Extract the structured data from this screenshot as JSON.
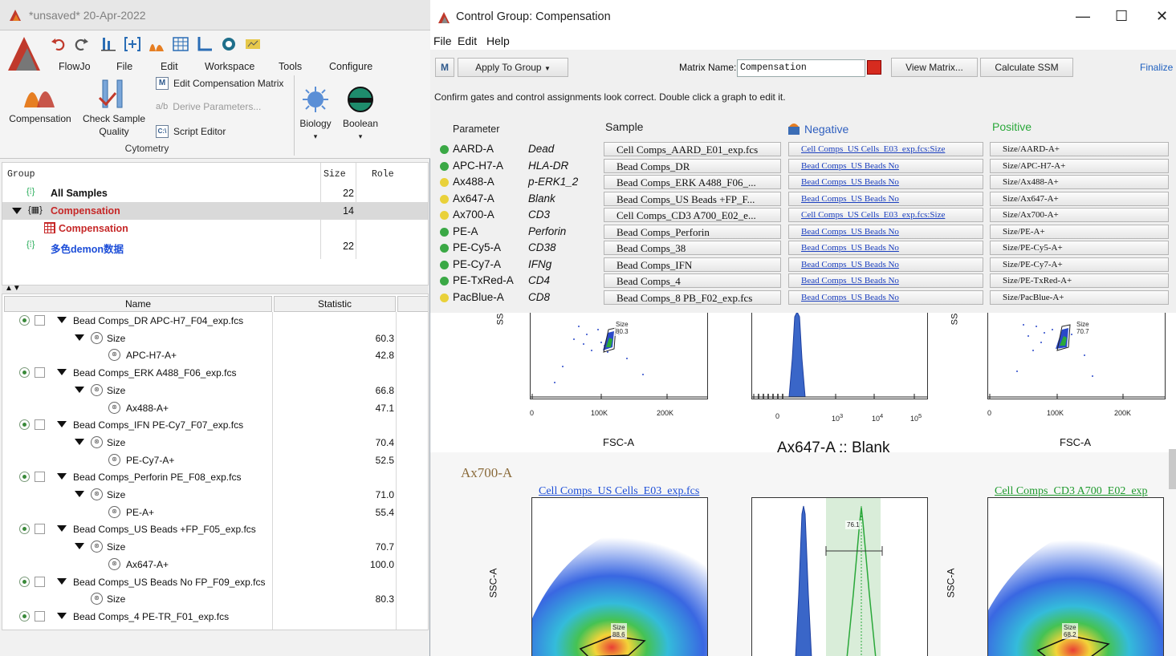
{
  "flowjo": {
    "title": "*unsaved* 20-Apr-2022",
    "menus": [
      "FlowJo",
      "File",
      "Edit",
      "Workspace",
      "Tools",
      "Configure"
    ],
    "ribbon": {
      "compensation": "Compensation",
      "check_sample_quality": "Check Sample Quality",
      "edit_comp_matrix": "Edit Compensation Matrix",
      "derive_parameters": "Derive Parameters...",
      "script_editor": "Script Editor",
      "biology": "Biology",
      "boolean": "Boolean",
      "section": "Cytometry"
    },
    "groups": {
      "headers": {
        "group": "Group",
        "size": "Size",
        "role": "Role"
      },
      "rows": [
        {
          "label": "All Samples",
          "size": "22",
          "color": "#111111"
        },
        {
          "label": "Compensation",
          "size": "14",
          "color": "#c62828"
        },
        {
          "label": "Compensation",
          "size": "",
          "color": "#c62828"
        },
        {
          "label": "多色demon数据",
          "size": "22",
          "color": "#1d4ed8"
        }
      ]
    },
    "samples": {
      "headers": {
        "name": "Name",
        "statistic": "Statistic"
      },
      "rows": [
        {
          "level": 0,
          "name": "Bead Comps_DR APC-H7_F04_exp.fcs",
          "stat": ""
        },
        {
          "level": 1,
          "name": "Size",
          "stat": "60.3"
        },
        {
          "level": 2,
          "name": "APC-H7-A+",
          "stat": "42.8"
        },
        {
          "level": 0,
          "name": "Bead Comps_ERK A488_F06_exp.fcs",
          "stat": ""
        },
        {
          "level": 1,
          "name": "Size",
          "stat": "66.8"
        },
        {
          "level": 2,
          "name": "Ax488-A+",
          "stat": "47.1"
        },
        {
          "level": 0,
          "name": "Bead Comps_IFN PE-Cy7_F07_exp.fcs",
          "stat": ""
        },
        {
          "level": 1,
          "name": "Size",
          "stat": "70.4"
        },
        {
          "level": 2,
          "name": "PE-Cy7-A+",
          "stat": "52.5"
        },
        {
          "level": 0,
          "name": "Bead Comps_Perforin PE_F08_exp.fcs",
          "stat": ""
        },
        {
          "level": 1,
          "name": "Size",
          "stat": "71.0"
        },
        {
          "level": 2,
          "name": "PE-A+",
          "stat": "55.4"
        },
        {
          "level": 0,
          "name": "Bead Comps_US Beads +FP_F05_exp.fcs",
          "stat": ""
        },
        {
          "level": 1,
          "name": "Size",
          "stat": "70.7"
        },
        {
          "level": 2,
          "name": "Ax647-A+",
          "stat": "100.0"
        },
        {
          "level": 0,
          "name": "Bead Comps_US Beads No FP_F09_exp.fcs",
          "stat": ""
        },
        {
          "level": 1,
          "name": "Size",
          "stat": "80.3",
          "nochild": true
        },
        {
          "level": 0,
          "name": "Bead Comps_4 PE-TR_F01_exp.fcs",
          "stat": ""
        }
      ]
    }
  },
  "cg": {
    "title": "Control Group: Compensation",
    "menus": [
      "File",
      "Edit",
      "Help"
    ],
    "apply_to_group": "Apply To Group",
    "matrix_label": "Matrix Name:",
    "matrix_name": "Compensation",
    "view_matrix": "View Matrix...",
    "calculate_ssm": "Calculate SSM",
    "finalize": "Finalize",
    "confirm_text": "Confirm gates and control assignments look correct. Double click a graph to edit it.",
    "table_headers": {
      "parameter": "Parameter",
      "sample": "Sample",
      "negative": "Negative",
      "positive": "Positive"
    },
    "params": [
      {
        "name": "AARD-A",
        "marker": "Dead",
        "status": "#3aa845",
        "sample": "Cell Comps_AARD_E01_exp.fcs",
        "negative": "Cell Comps_US Cells_E03_exp.fcs:Size",
        "positive": "Size/AARD-A+"
      },
      {
        "name": "APC-H7-A",
        "marker": "HLA-DR",
        "status": "#3aa845",
        "sample": "Bead Comps_DR",
        "negative": "Bead Comps_US Beads No",
        "positive": "Size/APC-H7-A+"
      },
      {
        "name": "Ax488-A",
        "marker": "p-ERK1_2",
        "status": "#e9d13a",
        "sample": "Bead Comps_ERK A488_F06_...",
        "negative": "Bead Comps_US Beads No",
        "positive": "Size/Ax488-A+"
      },
      {
        "name": "Ax647-A",
        "marker": "Blank",
        "status": "#e9d13a",
        "sample": "Bead Comps_US Beads +FP_F...",
        "negative": "Bead Comps_US Beads No",
        "positive": "Size/Ax647-A+"
      },
      {
        "name": "Ax700-A",
        "marker": "CD3",
        "status": "#e9d13a",
        "sample": "Cell Comps_CD3 A700_E02_e...",
        "negative": "Cell Comps_US Cells_E03_exp.fcs:Size",
        "positive": "Size/Ax700-A+"
      },
      {
        "name": "PE-A",
        "marker": "Perforin",
        "status": "#3aa845",
        "sample": "Bead Comps_Perforin",
        "negative": "Bead Comps_US Beads No",
        "positive": "Size/PE-A+"
      },
      {
        "name": "PE-Cy5-A",
        "marker": "CD38",
        "status": "#3aa845",
        "sample": "Bead Comps_38",
        "negative": "Bead Comps_US Beads No",
        "positive": "Size/PE-Cy5-A+"
      },
      {
        "name": "PE-Cy7-A",
        "marker": "IFNg",
        "status": "#3aa845",
        "sample": "Bead Comps_IFN",
        "negative": "Bead Comps_US Beads No",
        "positive": "Size/PE-Cy7-A+"
      },
      {
        "name": "PE-TxRed-A",
        "marker": "CD4",
        "status": "#3aa845",
        "sample": "Bead Comps_4",
        "negative": "Bead Comps_US Beads No",
        "positive": "Size/PE-TxRed-A+"
      },
      {
        "name": "PacBlue-A",
        "marker": "CD8",
        "status": "#e9d13a",
        "sample": "Bead Comps_8 PB_F02_exp.fcs",
        "negative": "Bead Comps_US Beads No",
        "positive": "Size/PacBlue-A+"
      }
    ],
    "plots": {
      "row1_center_title": "Ax647-A :: Blank",
      "row1_xlabel": "FSC-A",
      "row1_yaxis": "SS",
      "row1_left_gate": {
        "label": "Size",
        "value": "80.3"
      },
      "row1_right_gate": {
        "label": "Size",
        "value": "70.7"
      },
      "fsc_ticks": [
        "0",
        "100K",
        "200K"
      ],
      "log_ticks": [
        "0",
        "10",
        "10",
        "10"
      ],
      "log_exps": [
        "3",
        "4",
        "5"
      ],
      "row2_param": "Ax700-A",
      "row2_left_title": "Cell Comps_US Cells_E03_exp.fcs",
      "row2_right_title": "Cell Comps_CD3 A700_E02_exp",
      "row2_ylabel": "SSC-A",
      "row2_left_gate": {
        "label": "Size",
        "value": "88.6"
      },
      "row2_right_gate": {
        "label": "Size",
        "value": "68.2"
      },
      "row2_hist_gate": "76.1"
    }
  }
}
